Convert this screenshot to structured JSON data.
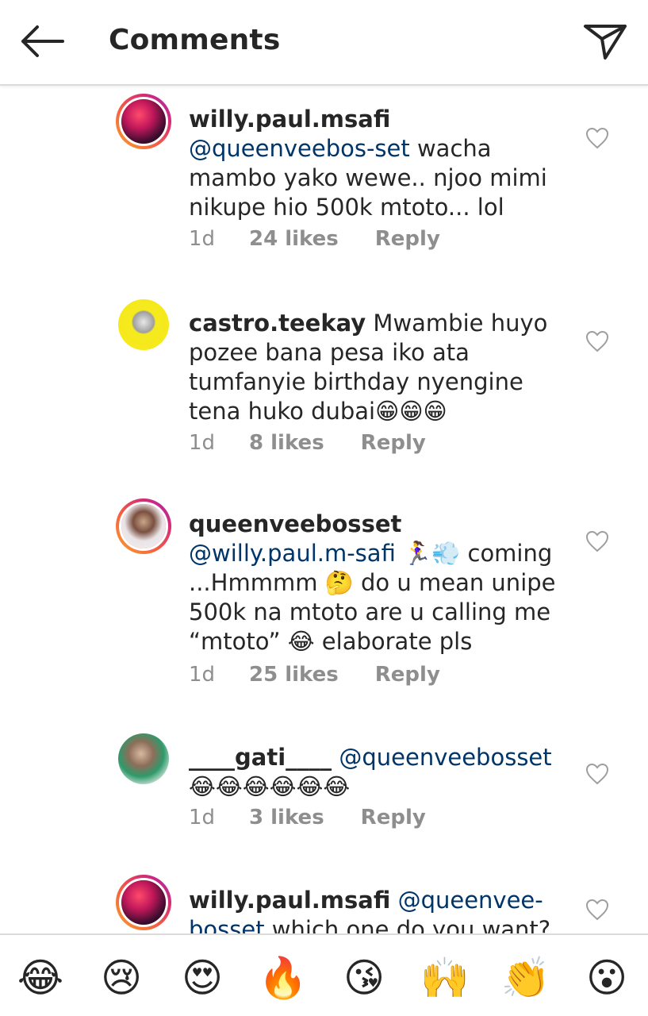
{
  "header": {
    "title": "Comments",
    "back_icon": "arrow-left-icon",
    "send_icon": "paper-plane-icon"
  },
  "colors": {
    "mention": "#003569",
    "meta_gray": "#8e8e8e",
    "text": "#262626",
    "divider": "#dbdbdb",
    "heart_gray": "#9e9e9e"
  },
  "comments": [
    {
      "username": "willy.paul.msafi",
      "mention": "@queenveebos-set",
      "text": " wacha mambo yako wewe.. njoo mimi nikupe hio 500k mtoto... lol",
      "time": "1d",
      "likes": "24 likes",
      "reply": "Reply",
      "story_ring": true
    },
    {
      "username": "castro.teekay",
      "mention": "",
      "text": " Mwambie huyo pozee bana pesa iko ata tumfanyie birthday nyengine tena huko dubai😁😁😁",
      "time": "1d",
      "likes": "8 likes",
      "reply": "Reply",
      "story_ring": false
    },
    {
      "username": "queenveebosset",
      "mention": "@willy.paul.m-safi",
      "text": " 🏃‍♀️💨 coming ...Hmmmm 🤔 do u mean unipe 500k na mtoto are u calling me “mtoto” 😂 elaborate pls",
      "time": "1d",
      "likes": "25 likes",
      "reply": "Reply",
      "story_ring": true
    },
    {
      "username": "____gati____",
      "mention": "@queenveebosset",
      "text": " 😂😂😂😂😂😂",
      "time": "1d",
      "likes": "3 likes",
      "reply": "Reply",
      "story_ring": false
    },
    {
      "username": "willy.paul.msafi",
      "mention": "@queenvee-bosset",
      "text": " which one do you want?",
      "time": "",
      "likes": "",
      "reply": "",
      "story_ring": true
    }
  ],
  "emoji_bar": [
    "😂",
    "😢",
    "😍",
    "🔥",
    "😘",
    "🙌",
    "👏",
    "😮"
  ]
}
